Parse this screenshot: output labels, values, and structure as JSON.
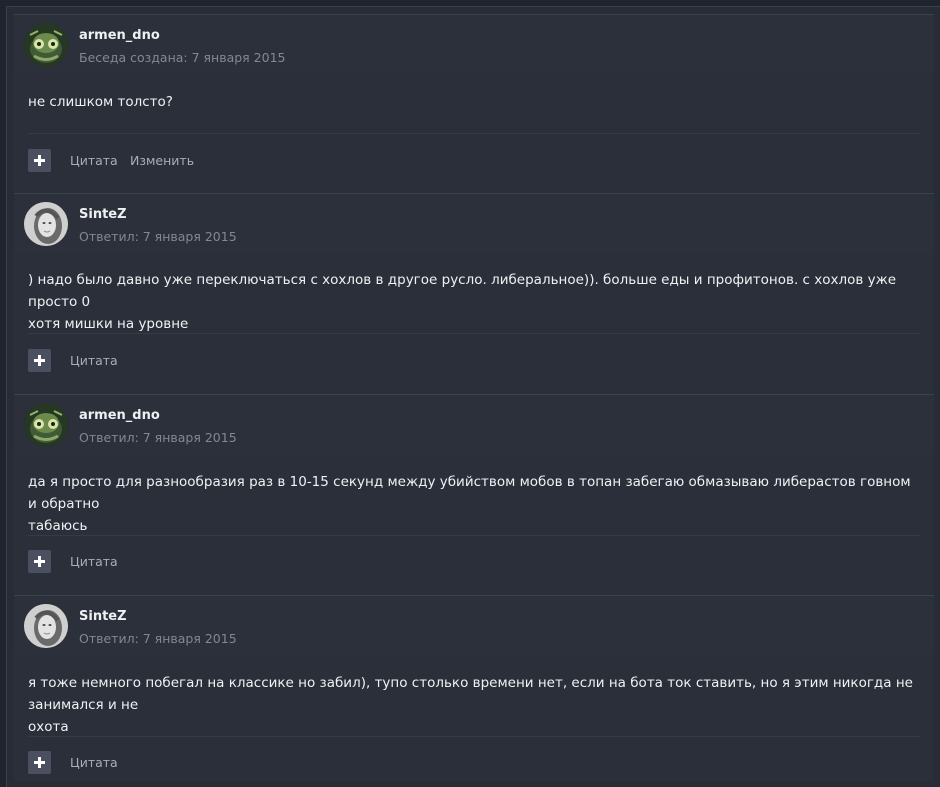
{
  "posts": [
    {
      "author": "armen_dno",
      "meta": "Беседа создана: 7 января 2015",
      "avatar": "green-mask-avatar",
      "lines": [
        "не слишком толсто?"
      ],
      "actions": [
        "Цитата",
        "Изменить"
      ]
    },
    {
      "author": "SinteZ",
      "meta": "Ответил: 7 января 2015",
      "avatar": "portrait-avatar",
      "lines": [
        ") надо было давно уже переключаться с хохлов в другое русло. либеральное)). больше еды и профитонов. с хохлов уже просто 0",
        "хотя мишки на уровне"
      ],
      "actions": [
        "Цитата"
      ]
    },
    {
      "author": "armen_dno",
      "meta": "Ответил: 7 января 2015",
      "avatar": "green-mask-avatar",
      "lines": [
        "да я просто для разнообразия раз в 10-15 секунд между убийством мобов в топан забегаю обмазываю либерастов говном и обратно",
        "табаюсь"
      ],
      "actions": [
        "Цитата"
      ]
    },
    {
      "author": "SinteZ",
      "meta": "Ответил: 7 января 2015",
      "avatar": "portrait-avatar",
      "lines": [
        "я тоже немного побегал на классике но забил), тупо столько времени нет, если на бота ток ставить, но я этим никогда не занимался и не",
        "охота"
      ],
      "actions": [
        "Цитата"
      ]
    }
  ]
}
